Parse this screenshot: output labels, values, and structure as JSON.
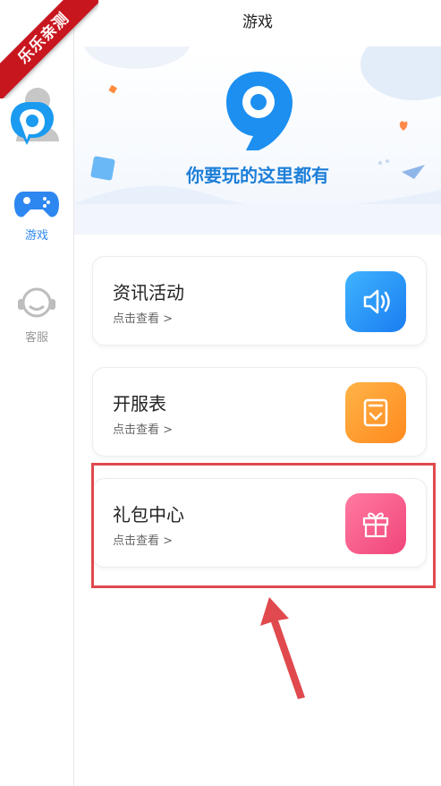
{
  "header": {
    "title": "游戏"
  },
  "ribbon": {
    "text": "乐乐亲测"
  },
  "sidebar": {
    "avatar_label": "",
    "items": [
      {
        "label": "游戏",
        "icon": "gamepad-icon",
        "active": true
      },
      {
        "label": "客服",
        "icon": "headset-icon",
        "active": false
      }
    ]
  },
  "banner": {
    "slogan": "你要玩的这里都有",
    "logo": "9-logo-icon"
  },
  "cards": [
    {
      "title": "资讯活动",
      "sub": "点击查看 >",
      "icon": "speaker-icon",
      "color": "#2a8ff5"
    },
    {
      "title": "开服表",
      "sub": "点击查看 >",
      "icon": "calendar-icon",
      "color": "#ff9a2e"
    },
    {
      "title": "礼包中心",
      "sub": "点击查看 >",
      "icon": "gift-icon",
      "color": "#f25585"
    }
  ],
  "colors": {
    "accent": "#2d87f0",
    "highlight": "#e0494d",
    "ribbon": "#c8161e"
  }
}
